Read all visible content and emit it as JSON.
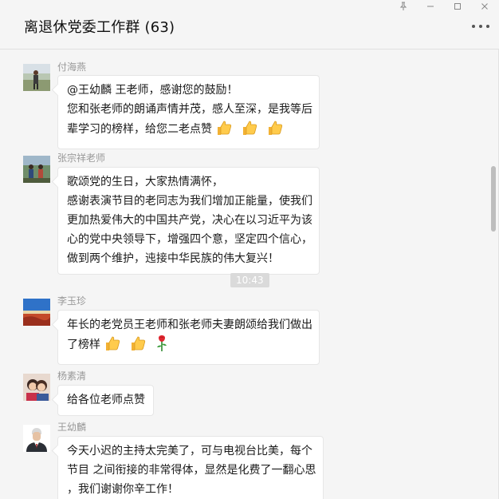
{
  "window": {
    "title": "离退休党委工作群 (63)",
    "buttons": [
      "pin",
      "minimize",
      "maximize",
      "close"
    ]
  },
  "messages": [
    {
      "sender": "付海燕",
      "lines": [
        "@王幼麟  王老师，感谢您的鼓励！",
        "您和张老师的朗诵声情并茂，感人至深，是我等后",
        "辈学习的榜样，给您二老点赞"
      ],
      "emoji": [
        "thumbs-up",
        "thumbs-up",
        "thumbs-up"
      ]
    },
    {
      "sender": "张宗祥老师",
      "lines": [
        "歌颂党的生日，大家热情满怀，",
        "感谢表演节目的老同志为我们增加正能量，使我们",
        "更加热爱伟大的中国共产党，决心在以习近平为该",
        "心的党中央领导下，增强四个意，坚定四个信心，",
        "做到两个维护，迍接中华民族的伟大复兴！"
      ]
    },
    {
      "sender": "李玉珍",
      "lines": [
        "年长的老党员王老师和张老师夫妻朗颂给我们做出",
        "了榜样"
      ],
      "emoji": [
        "thumbs-up",
        "thumbs-up",
        "rose"
      ]
    },
    {
      "sender": "杨素清",
      "lines": [
        "给各位老师点赞"
      ]
    },
    {
      "sender": "王幼麟",
      "lines": [
        "今天小迟的主持太完美了，可与电视台比美，每个",
        "节目 之间衔接的非常得体，显然是化费了一翻心思",
        "，我们谢谢你辛工作！"
      ]
    }
  ],
  "timestamp": "10:43",
  "colors": {
    "background": "#f5f5f5",
    "bubble": "#ffffff",
    "sender_name": "#999999",
    "timestamp_bg": "#dadada"
  }
}
